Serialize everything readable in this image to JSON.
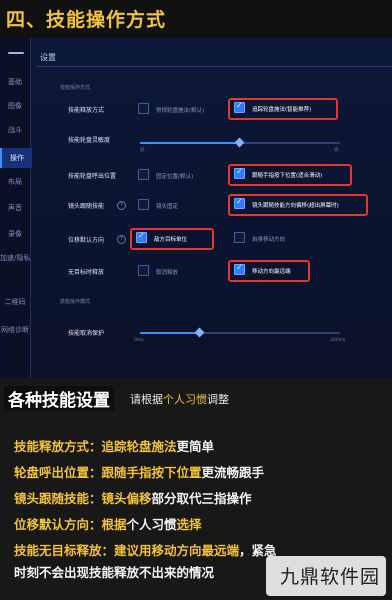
{
  "banner": {
    "title": "四、技能操作方式"
  },
  "settings": {
    "title": "设置",
    "sidebar": [
      "基础",
      "图像",
      "战斗",
      "操作",
      "布局",
      "声音",
      "录像",
      "加速/隐私",
      "二维码",
      "网络诊断"
    ],
    "section1": "技能操作方式",
    "section2": "技能操作模式",
    "rows": {
      "cast_mode": {
        "label": "技能释放方式",
        "opt_a": "常规轮盘施法(默认)",
        "opt_b": "追踪轮盘施法(智能推荐)"
      },
      "sensitivity": {
        "label": "技能轮盘灵敏度",
        "min": "低",
        "max": "高",
        "value": 0.5
      },
      "popup_pos": {
        "label": "技能轮盘呼出位置",
        "opt_a": "固定位置(默认)",
        "opt_b": "跟随手指按下位置(适合滑动)"
      },
      "camera_follow": {
        "label": "镜头跟随技能",
        "opt_a": "镜头固定",
        "opt_b": "镜头跟随技能方向偏移(超出屏幕时)"
      },
      "displacement": {
        "label": "位移默认方向",
        "opt_a": "敌方目标单位",
        "opt_b": "自身移动方向"
      },
      "no_target": {
        "label": "无目标时释放",
        "opt_a": "取消释放",
        "opt_b": "移动方向最远端"
      },
      "cancel_protect": {
        "label": "技能取消保护",
        "min": "0ms",
        "max": "200ms",
        "value": 0.3
      }
    }
  },
  "card": {
    "headline": "各种技能设置",
    "sub_pre": "请根据",
    "sub_hl": "个人习惯",
    "sub_post": "调整",
    "lines": [
      {
        "a": "技能释放方式：",
        "b": "追踪轮盘施法",
        "c": "更简单",
        "d": ""
      },
      {
        "a": "轮盘呼出位置：",
        "b": "跟随手指按下位置",
        "c": "更流畅跟手",
        "d": ""
      },
      {
        "a": "镜头跟随技能：",
        "b": "镜头偏移",
        "c": "部分取代三指操作",
        "d": ""
      },
      {
        "a": "位移默认方向：",
        "b": "根据",
        "c": "个人习惯",
        "d": "选择"
      },
      {
        "a": "技能无目标释放：",
        "b": "建议用移动方向最远端",
        "c": "，紧急",
        "d": ""
      }
    ],
    "line6": "时刻不会出现技能释放不出来的情况"
  },
  "watermark": "九鼎软件园",
  "colors": {
    "accent_yellow": "#f3c23a",
    "highlight_red": "#e6372f",
    "ui_blue": "#2f7bff"
  }
}
